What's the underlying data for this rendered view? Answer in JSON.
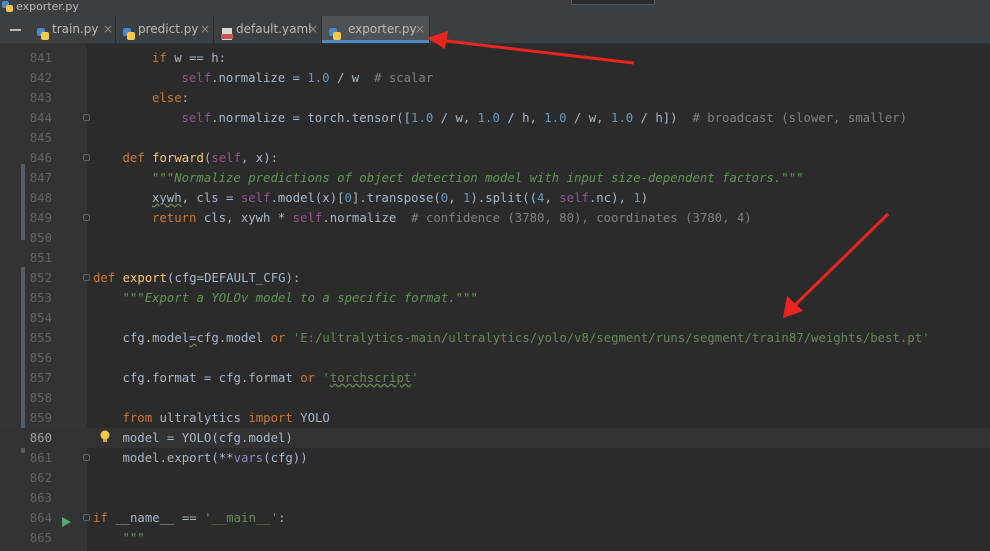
{
  "window": {
    "title": "exporter.py",
    "title_icon": "python-file-icon"
  },
  "tabs": [
    {
      "label": "train.py",
      "icon": "python-file-icon",
      "active": false
    },
    {
      "label": "predict.py",
      "icon": "python-file-icon",
      "active": false
    },
    {
      "label": "default.yaml",
      "icon": "yaml-file-icon",
      "active": false
    },
    {
      "label": "exporter.py",
      "icon": "python-file-icon",
      "active": true
    }
  ],
  "tab_close_glyph": "×",
  "editor": {
    "current_line": 860,
    "lines": [
      {
        "n": "841",
        "indent": 2,
        "tokens": [
          [
            "kw",
            "if "
          ],
          [
            "",
            "w == h:"
          ]
        ]
      },
      {
        "n": "842",
        "indent": 3,
        "tokens": [
          [
            "self",
            "self"
          ],
          [
            "",
            ".normalize = "
          ],
          [
            "num",
            "1.0"
          ],
          [
            "",
            " / w  "
          ],
          [
            "cmt",
            "# scalar"
          ]
        ]
      },
      {
        "n": "843",
        "indent": 2,
        "tokens": [
          [
            "kw",
            "else"
          ],
          [
            "",
            ":"
          ]
        ]
      },
      {
        "n": "844",
        "indent": 3,
        "fold": true,
        "tokens": [
          [
            "self",
            "self"
          ],
          [
            "",
            ".normalize = torch.tensor(["
          ],
          [
            "num",
            "1.0"
          ],
          [
            "",
            " / w, "
          ],
          [
            "num",
            "1.0"
          ],
          [
            "",
            " / h, "
          ],
          [
            "num",
            "1.0"
          ],
          [
            "",
            " / w, "
          ],
          [
            "num",
            "1.0"
          ],
          [
            "",
            " / h])  "
          ],
          [
            "cmt",
            "# broadcast (slower, smaller)"
          ]
        ]
      },
      {
        "n": "845",
        "indent": 0,
        "tokens": []
      },
      {
        "n": "846",
        "indent": 1,
        "fold": true,
        "tokens": [
          [
            "kw",
            "def "
          ],
          [
            "fn",
            "forward"
          ],
          [
            "",
            "("
          ],
          [
            "self",
            "self"
          ],
          [
            "",
            ", x):"
          ]
        ]
      },
      {
        "n": "847",
        "indent": 2,
        "tokens": [
          [
            "doc",
            "\"\"\"Normalize predictions of object detection model with input size-dependent factors.\"\"\""
          ]
        ]
      },
      {
        "n": "848",
        "indent": 2,
        "tokens": [
          [
            "err",
            "xywh"
          ],
          [
            "",
            ", cls = "
          ],
          [
            "self",
            "self"
          ],
          [
            "",
            ".model(x)["
          ],
          [
            "num",
            "0"
          ],
          [
            "",
            "].transpose("
          ],
          [
            "num",
            "0"
          ],
          [
            "",
            ", "
          ],
          [
            "num",
            "1"
          ],
          [
            "",
            ").split(("
          ],
          [
            "num",
            "4"
          ],
          [
            "",
            ", "
          ],
          [
            "self",
            "self"
          ],
          [
            "",
            ".nc), "
          ],
          [
            "num",
            "1"
          ],
          [
            "",
            ")"
          ]
        ]
      },
      {
        "n": "849",
        "indent": 2,
        "fold": true,
        "tokens": [
          [
            "kw",
            "return "
          ],
          [
            "",
            "cls, xywh * "
          ],
          [
            "self",
            "self"
          ],
          [
            "",
            ".normalize  "
          ],
          [
            "cmt",
            "# confidence (3780, 80), coordinates (3780, 4)"
          ]
        ]
      },
      {
        "n": "850",
        "indent": 0,
        "tokens": []
      },
      {
        "n": "851",
        "indent": 0,
        "tokens": []
      },
      {
        "n": "852",
        "indent": 0,
        "fold": true,
        "tokens": [
          [
            "kw",
            "def "
          ],
          [
            "fn",
            "export"
          ],
          [
            "",
            "(cfg=DEFAULT_CFG):"
          ]
        ]
      },
      {
        "n": "853",
        "indent": 1,
        "tokens": [
          [
            "doc",
            "\"\"\"Export a YOLOv model to a specific format.\"\"\""
          ]
        ]
      },
      {
        "n": "854",
        "indent": 0,
        "tokens": []
      },
      {
        "n": "855",
        "indent": 1,
        "tokens": [
          [
            "",
            "cfg.model"
          ],
          [
            "err",
            "="
          ],
          [
            "",
            "cfg.model "
          ],
          [
            "kw",
            "or "
          ],
          [
            "str",
            "'E:/ultralytics-main/ultralytics/yolo/v8/segment/runs/segment/train87/weights/best.pt'"
          ]
        ]
      },
      {
        "n": "856",
        "indent": 0,
        "tokens": []
      },
      {
        "n": "857",
        "indent": 1,
        "tokens": [
          [
            "",
            "cfg.format = cfg.format "
          ],
          [
            "kw",
            "or "
          ],
          [
            "str",
            "'"
          ],
          [
            "str err",
            "torchscript"
          ],
          [
            "str",
            "'"
          ]
        ]
      },
      {
        "n": "858",
        "indent": 0,
        "tokens": []
      },
      {
        "n": "859",
        "indent": 1,
        "tokens": [
          [
            "kw",
            "from "
          ],
          [
            "",
            "ultralytics "
          ],
          [
            "kw",
            "import "
          ],
          [
            "",
            "YOLO"
          ]
        ]
      },
      {
        "n": "860",
        "indent": 1,
        "bulb": true,
        "tokens": [
          [
            "",
            "model = YOLO(cfg.model)"
          ]
        ]
      },
      {
        "n": "861",
        "indent": 1,
        "fold": true,
        "tokens": [
          [
            "",
            "model.export(**"
          ],
          [
            "bi",
            "vars"
          ],
          [
            "",
            "(cfg))"
          ]
        ]
      },
      {
        "n": "862",
        "indent": 0,
        "tokens": []
      },
      {
        "n": "863",
        "indent": 0,
        "tokens": []
      },
      {
        "n": "864",
        "indent": 0,
        "fold": true,
        "run": true,
        "tokens": [
          [
            "kw",
            "if "
          ],
          [
            "",
            "__name__ == "
          ],
          [
            "str",
            "'__main__'"
          ],
          [
            "",
            ":"
          ]
        ]
      },
      {
        "n": "865",
        "indent": 1,
        "tokens": [
          [
            "doc",
            "\"\"\""
          ]
        ]
      }
    ]
  },
  "annotations": {
    "arrow_color": "#e8261f",
    "count": 2
  }
}
